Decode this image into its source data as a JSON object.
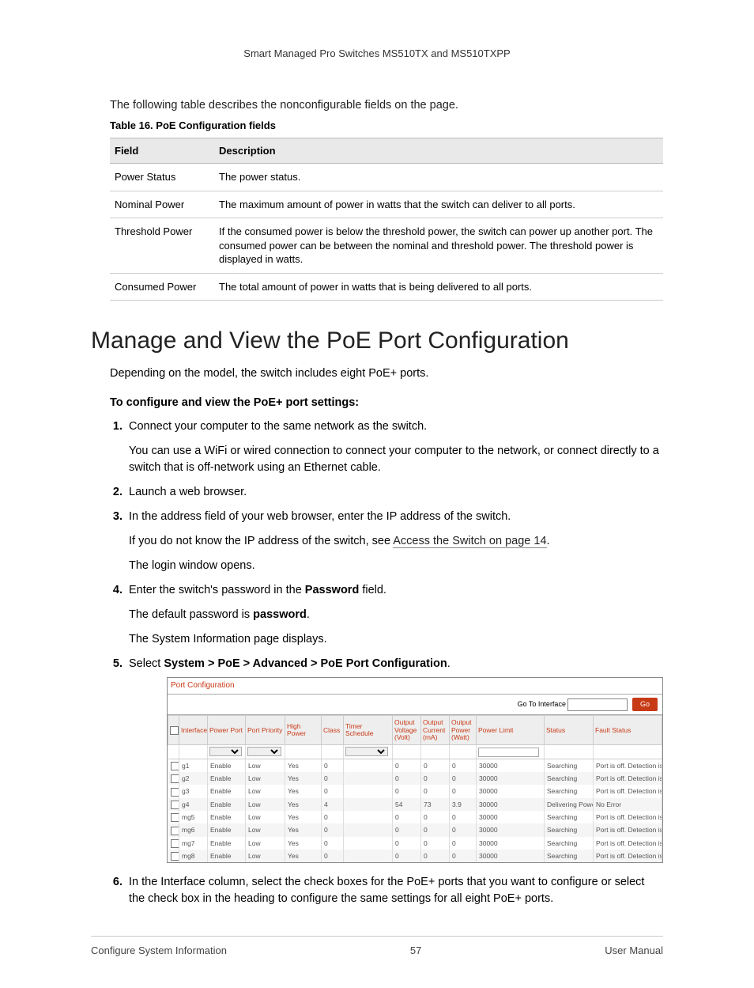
{
  "doc_header": "Smart Managed Pro Switches MS510TX and MS510TXPP",
  "intro": "The following table describes the nonconfigurable fields on the page.",
  "table_caption": "Table 16.  PoE Configuration fields",
  "field_table": {
    "headers": [
      "Field",
      "Description"
    ],
    "rows": [
      {
        "field": "Power Status",
        "desc": "The power status."
      },
      {
        "field": "Nominal Power",
        "desc": "The maximum amount of power in watts that the switch can deliver to all ports."
      },
      {
        "field": "Threshold Power",
        "desc": "If the consumed power is below the threshold power, the switch can power up another port. The consumed power can be between the nominal and threshold power. The threshold power is displayed in watts."
      },
      {
        "field": "Consumed Power",
        "desc": "The total amount of power in watts that is being delivered to all ports."
      }
    ]
  },
  "section_title": "Manage and View the PoE Port Configuration",
  "section_intro": "Depending on the model, the switch includes eight PoE+ ports.",
  "subheading": "To configure and view the PoE+ port settings:",
  "steps": {
    "s1": "Connect your computer to the same network as the switch.",
    "s1_p": "You can use a WiFi or wired connection to connect your computer to the network, or connect directly to a switch that is off-network using an Ethernet cable.",
    "s2": "Launch a web browser.",
    "s3": "In the address field of your web browser, enter the IP address of the switch.",
    "s3_p_prefix": "If you do not know the IP address of the switch, see ",
    "s3_link": "Access the Switch on page 14",
    "s3_p_suffix": ".",
    "s3_p2": "The login window opens.",
    "s4_prefix": "Enter the switch's password in the ",
    "s4_bold": "Password",
    "s4_suffix": " field.",
    "s4_p_prefix": "The default password is ",
    "s4_p_bold": "password",
    "s4_p_suffix": ".",
    "s4_p2": "The System Information page displays.",
    "s5_prefix": "Select ",
    "s5_bold": "System > PoE > Advanced > PoE Port Configuration",
    "s5_suffix": ".",
    "s6": "In the Interface column, select the check boxes for the PoE+ ports that you want to configure or select the check box in the heading to configure the same settings for all eight PoE+ ports."
  },
  "screenshot": {
    "title": "Port Configuration",
    "goto_label": "Go To Interface",
    "go_button": "Go",
    "headers": [
      "",
      "Interface",
      "Power Port",
      "Port Priority",
      "High Power",
      "Class",
      "Timer Schedule",
      "Output Voltage (Volt)",
      "Output Current (mA)",
      "Output Power (Watt)",
      "Power Limit",
      "Status",
      "Fault Status"
    ],
    "rows": [
      {
        "iface": "g1",
        "pp": "Enable",
        "prio": "Low",
        "hp": "Yes",
        "cls": "0",
        "ts": "",
        "ov": "0",
        "oc": "0",
        "op": "0",
        "pl": "30000",
        "st": "Searching",
        "fs": "Port is off. Detection is in process"
      },
      {
        "iface": "g2",
        "pp": "Enable",
        "prio": "Low",
        "hp": "Yes",
        "cls": "0",
        "ts": "",
        "ov": "0",
        "oc": "0",
        "op": "0",
        "pl": "30000",
        "st": "Searching",
        "fs": "Port is off. Detection is in process"
      },
      {
        "iface": "g3",
        "pp": "Enable",
        "prio": "Low",
        "hp": "Yes",
        "cls": "0",
        "ts": "",
        "ov": "0",
        "oc": "0",
        "op": "0",
        "pl": "30000",
        "st": "Searching",
        "fs": "Port is off. Detection is in process"
      },
      {
        "iface": "g4",
        "pp": "Enable",
        "prio": "Low",
        "hp": "Yes",
        "cls": "4",
        "ts": "",
        "ov": "54",
        "oc": "73",
        "op": "3.9",
        "pl": "30000",
        "st": "Delivering Power",
        "fs": "No Error"
      },
      {
        "iface": "mg5",
        "pp": "Enable",
        "prio": "Low",
        "hp": "Yes",
        "cls": "0",
        "ts": "",
        "ov": "0",
        "oc": "0",
        "op": "0",
        "pl": "30000",
        "st": "Searching",
        "fs": "Port is off. Detection is in process"
      },
      {
        "iface": "mg6",
        "pp": "Enable",
        "prio": "Low",
        "hp": "Yes",
        "cls": "0",
        "ts": "",
        "ov": "0",
        "oc": "0",
        "op": "0",
        "pl": "30000",
        "st": "Searching",
        "fs": "Port is off. Detection is in process"
      },
      {
        "iface": "mg7",
        "pp": "Enable",
        "prio": "Low",
        "hp": "Yes",
        "cls": "0",
        "ts": "",
        "ov": "0",
        "oc": "0",
        "op": "0",
        "pl": "30000",
        "st": "Searching",
        "fs": "Port is off. Detection is in process"
      },
      {
        "iface": "mg8",
        "pp": "Enable",
        "prio": "Low",
        "hp": "Yes",
        "cls": "0",
        "ts": "",
        "ov": "0",
        "oc": "0",
        "op": "0",
        "pl": "30000",
        "st": "Searching",
        "fs": "Port is off. Detection is in process"
      }
    ]
  },
  "footer": {
    "left": "Configure System Information",
    "center": "57",
    "right": "User Manual"
  }
}
